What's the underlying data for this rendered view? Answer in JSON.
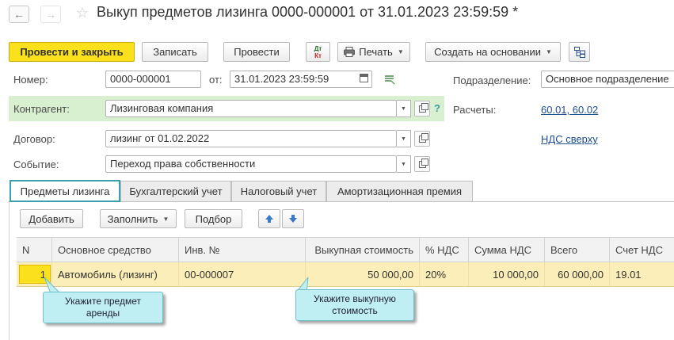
{
  "window": {
    "title": "Выкуп предметов лизинга 0000-000001 от 31.01.2023 23:59:59 *",
    "back_icon": "←",
    "forward_icon": "→",
    "star_icon": "☆"
  },
  "toolbar": {
    "post_close": "Провести и закрыть",
    "save": "Записать",
    "post": "Провести",
    "dt_kt_top": "Дт",
    "dt_kt_bottom": "Кт",
    "print": "Печать",
    "create_based": "Создать на основании"
  },
  "header": {
    "number_label": "Номер:",
    "number_value": "0000-000001",
    "date_label": "от:",
    "date_value": "31.01.2023 23:59:59",
    "division_label": "Подразделение:",
    "division_value": "Основное подразделение",
    "counterparty_label": "Контрагент:",
    "counterparty_value": "Лизинговая компания",
    "help_mark": "?",
    "settlements_label": "Расчеты:",
    "settlements_value": "60.01, 60.02",
    "contract_label": "Договор:",
    "contract_value": "лизинг от 01.02.2022",
    "vat_link": "НДС сверху",
    "event_label": "Событие:",
    "event_value": "Переход права собственности"
  },
  "tabs": [
    {
      "label": "Предметы лизинга",
      "active": true
    },
    {
      "label": "Бухгалтерский учет",
      "active": false
    },
    {
      "label": "Налоговый учет",
      "active": false
    },
    {
      "label": "Амортизационная премия",
      "active": false
    }
  ],
  "table_toolbar": {
    "add": "Добавить",
    "fill": "Заполнить",
    "select": "Подбор"
  },
  "table": {
    "columns": [
      "N",
      "Основное средство",
      "Инв. №",
      "Выкупная стоимость",
      "% НДС",
      "Сумма НДС",
      "Всего",
      "Счет НДС"
    ],
    "rows": [
      [
        "1",
        "Автомобиль (лизинг)",
        "00-000007",
        "50 000,00",
        "20%",
        "10 000,00",
        "60 000,00",
        "19.01"
      ]
    ]
  },
  "callouts": {
    "left": "Укажите предмет аренды",
    "right": "Укажите выкупную стоимость"
  },
  "colors": {
    "primary_button": "#fbe11c",
    "selected_row": "#fbeeb8",
    "active_tab_border": "#3aa0b0",
    "counterparty_band": "#d8efd0",
    "callout_bg": "#bfeff3",
    "link": "#1c4e8c"
  }
}
